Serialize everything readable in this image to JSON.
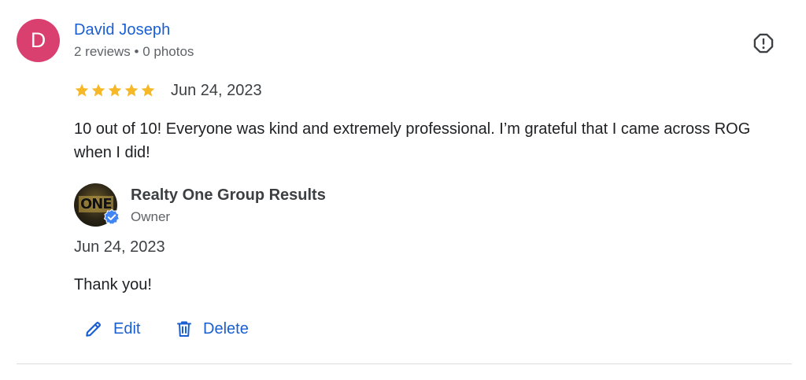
{
  "reviewer": {
    "initial": "D",
    "name": "David Joseph",
    "stats": "2 reviews • 0 photos",
    "avatar_color": "#d93f6f"
  },
  "review": {
    "rating": 5,
    "max_rating": 5,
    "star_color": "#f6b826",
    "date": "Jun 24, 2023",
    "text": "10 out of 10! Everyone was kind and extremely professional. I’m grateful that I came across ROG when I did!"
  },
  "owner_reply": {
    "name": "Realty One Group Results",
    "role": "Owner",
    "logo_text": "ONE",
    "date": "Jun 24, 2023",
    "text": "Thank you!"
  },
  "actions": {
    "edit_label": "Edit",
    "delete_label": "Delete"
  },
  "icons": {
    "flag": "report-flag-icon",
    "star": "star-icon",
    "verified": "verified-badge-icon",
    "edit": "pencil-icon",
    "delete": "trash-icon"
  },
  "colors": {
    "link": "#1a5fd1",
    "verified": "#4285f4",
    "divider": "#dadce0"
  }
}
